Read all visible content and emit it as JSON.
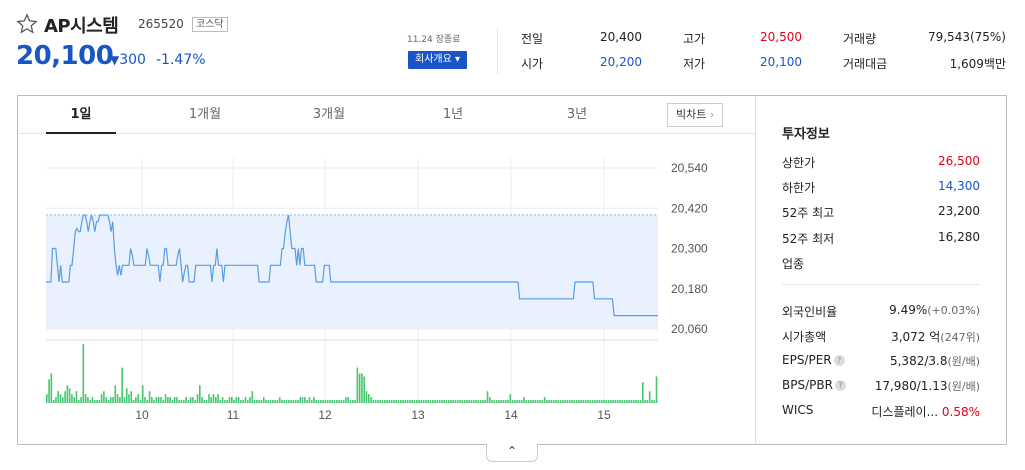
{
  "header": {
    "name": "AP시스템",
    "code": "265520",
    "market": "코스닥",
    "price": "20,100",
    "change_arrow": "▼",
    "change": "300",
    "rate": "-1.47%",
    "time": "11.24 장종료",
    "company_button": "회사개요 ▾"
  },
  "quotes": {
    "prev_label": "전일",
    "prev": "20,400",
    "high_label": "고가",
    "high": "20,500",
    "volume_label": "거래량",
    "volume": "79,543(75%)",
    "open_label": "시가",
    "open": "20,200",
    "low_label": "저가",
    "low": "20,100",
    "amount_label": "거래대금",
    "amount": "1,609백만"
  },
  "tabs": [
    "1일",
    "1개월",
    "3개월",
    "1년",
    "3년"
  ],
  "big_chart_button": "빅차트",
  "investment": {
    "title": "투자정보",
    "rows": [
      {
        "label": "상한가",
        "value": "26,500",
        "color": "red"
      },
      {
        "label": "하한가",
        "value": "14,300",
        "color": "blue"
      },
      {
        "label": "52주 최고",
        "value": "23,200",
        "color": ""
      },
      {
        "label": "52주 최저",
        "value": "16,280",
        "color": ""
      },
      {
        "label": "업종",
        "value": "",
        "color": ""
      }
    ],
    "rows2": [
      {
        "label": "외국인비율",
        "value": "9.49%",
        "extra": "(+0.03%)"
      },
      {
        "label": "시가총액",
        "value": "3,072 억",
        "extra": "(247위)"
      },
      {
        "label": "EPS/PER",
        "value": "5,382/3.8",
        "extra": "(원/배)"
      },
      {
        "label": "BPS/PBR",
        "value": "17,980/1.13",
        "extra": "(원/배)"
      },
      {
        "label": "WICS",
        "value": "디스플레이...",
        "extra": "0.58%"
      }
    ]
  },
  "chart_data": {
    "type": "line",
    "y_ticks": [
      "20,540",
      "20,420",
      "20,300",
      "20,180",
      "20,060"
    ],
    "x_ticks": [
      "10",
      "11",
      "12",
      "13",
      "14",
      "15"
    ],
    "prev_close": 20400,
    "ylim": [
      20060,
      20540
    ],
    "colors": {
      "line": "#5a9be8",
      "fill": "#e8f1fd",
      "volume": "#46c66c"
    },
    "price": [
      20200,
      20200,
      20200,
      20200,
      20300,
      20300,
      20300,
      20250,
      20200,
      20250,
      20200,
      20200,
      20200,
      20200,
      20200,
      20250,
      20250,
      20300,
      20350,
      20360,
      20350,
      20350,
      20380,
      20400,
      20400,
      20380,
      20350,
      20380,
      20400,
      20380,
      20350,
      20380,
      20380,
      20400,
      20400,
      20400,
      20400,
      20400,
      20400,
      20380,
      20350,
      20380,
      20300,
      20250,
      20220,
      20250,
      20220,
      20250,
      20250,
      20250,
      20250,
      20250,
      20300,
      20280,
      20250,
      20250,
      20250,
      20250,
      20250,
      20250,
      20250,
      20250,
      20300,
      20280,
      20250,
      20250,
      20250,
      20250,
      20250,
      20250,
      20200,
      20250,
      20250,
      20300,
      20300,
      20250,
      20250,
      20250,
      20250,
      20250,
      20250,
      20280,
      20300,
      20250,
      20200,
      20230,
      20250,
      20250,
      20200,
      20200,
      20200,
      20200,
      20250,
      20250,
      20250,
      20250,
      20250,
      20250,
      20250,
      20250,
      20250,
      20250,
      20200,
      20250,
      20250,
      20300,
      20250,
      20250,
      20250,
      20200,
      20250,
      20250,
      20250,
      20250,
      20250,
      20250,
      20250,
      20250,
      20250,
      20250,
      20250,
      20250,
      20250,
      20250,
      20250,
      20250,
      20250,
      20250,
      20250,
      20250,
      20250,
      20200,
      20200,
      20200,
      20200,
      20200,
      20200,
      20200,
      20250,
      20250,
      20250,
      20250,
      20250,
      20250,
      20250,
      20300,
      20300,
      20350,
      20380,
      20400,
      20350,
      20300,
      20300,
      20300,
      20250,
      20300,
      20250,
      20300,
      20300,
      20250,
      20250,
      20250,
      20250,
      20250,
      20250,
      20250,
      20200,
      20200,
      20200,
      20200,
      20200,
      20250,
      20250,
      20250,
      20250,
      20200,
      20200,
      20200,
      20200,
      20200,
      20200,
      20200,
      20200,
      20200,
      20200,
      20200,
      20200,
      20200,
      20200,
      20200,
      20200,
      20200,
      20200,
      20200,
      20200,
      20200,
      20200,
      20200,
      20200,
      20200,
      20200,
      20200,
      20200,
      20200,
      20200,
      20200,
      20200,
      20200,
      20200,
      20200,
      20200,
      20200,
      20200,
      20200,
      20200,
      20200,
      20200,
      20200,
      20200,
      20200,
      20200,
      20200,
      20200,
      20200,
      20200,
      20200,
      20200,
      20200,
      20200,
      20200,
      20200,
      20200,
      20200,
      20200,
      20200,
      20200,
      20200,
      20200,
      20200,
      20200,
      20200,
      20200,
      20200,
      20200,
      20200,
      20200,
      20200,
      20200,
      20200,
      20200,
      20200,
      20200,
      20200,
      20200,
      20200,
      20200,
      20200,
      20200,
      20200,
      20200,
      20200,
      20200,
      20200,
      20200,
      20200,
      20200,
      20200,
      20200,
      20200,
      20200,
      20200,
      20200,
      20200,
      20200,
      20200,
      20200,
      20200,
      20200,
      20200,
      20200,
      20200,
      20200,
      20200,
      20200,
      20200,
      20200,
      20200,
      20200,
      20200,
      20200,
      20200,
      20150,
      20150,
      20150,
      20150,
      20150,
      20150,
      20150,
      20150,
      20150,
      20150,
      20150,
      20150,
      20150,
      20150,
      20150,
      20150,
      20150,
      20150,
      20150,
      20150,
      20150,
      20150,
      20150,
      20150,
      20150,
      20150,
      20150,
      20150,
      20150,
      20150,
      20150,
      20150,
      20150,
      20150,
      20200,
      20200,
      20200,
      20200,
      20200,
      20200,
      20200,
      20200,
      20200,
      20200,
      20200,
      20200,
      20150,
      20150,
      20150,
      20150,
      20150,
      20150,
      20150,
      20150,
      20150,
      20150,
      20150,
      20150,
      20100,
      20100,
      20100,
      20100,
      20100,
      20100,
      20100,
      20100,
      20100,
      20100,
      20100,
      20100,
      20100,
      20100,
      20100,
      20100,
      20100,
      20100,
      20100,
      20100,
      20100,
      20100,
      20100,
      20100,
      20100,
      20100,
      20100,
      20100
    ],
    "volume": [
      3,
      8,
      10,
      1,
      2,
      4,
      3,
      2,
      4,
      6,
      5,
      3,
      2,
      4,
      1,
      2,
      20,
      3,
      2,
      1,
      2,
      1,
      1,
      1,
      3,
      4,
      2,
      1,
      2,
      2,
      6,
      3,
      2,
      12,
      2,
      5,
      3,
      4,
      1,
      2,
      3,
      1,
      6,
      2,
      1,
      4,
      2,
      1,
      2,
      2,
      2,
      1,
      3,
      2,
      2,
      1,
      2,
      2,
      1,
      1,
      1,
      2,
      1,
      2,
      2,
      1,
      3,
      6,
      2,
      1,
      1,
      3,
      2,
      3,
      2,
      3,
      1,
      2,
      1,
      1,
      2,
      2,
      1,
      2,
      2,
      1,
      1,
      2,
      1,
      2,
      4,
      1,
      1,
      1,
      1,
      2,
      1,
      1,
      1,
      1,
      1,
      1,
      2,
      1,
      1,
      1,
      1,
      1,
      1,
      1,
      1,
      2,
      2,
      2,
      1,
      2,
      1,
      2,
      1,
      1,
      1,
      1,
      1,
      1,
      1,
      1,
      1,
      1,
      1,
      1,
      1,
      2,
      2,
      1,
      1,
      1,
      12,
      10,
      10,
      9,
      4,
      3,
      2,
      1,
      1,
      1,
      1,
      1,
      1,
      1,
      1,
      1,
      1,
      1,
      1,
      1,
      1,
      1,
      1,
      1,
      1,
      1,
      1,
      1,
      1,
      1,
      1,
      1,
      1,
      1,
      1,
      1,
      1,
      1,
      1,
      1,
      1,
      1,
      1,
      1,
      1,
      1,
      1,
      1,
      1,
      1,
      1,
      1,
      1,
      1,
      1,
      1,
      1,
      4,
      2,
      1,
      1,
      1,
      1,
      1,
      1,
      1,
      1,
      3,
      1,
      1,
      1,
      1,
      1,
      2,
      1,
      1,
      1,
      1,
      1,
      1,
      1,
      1,
      2,
      1,
      1,
      1,
      1,
      1,
      1,
      1,
      1,
      1,
      1,
      1,
      1,
      1,
      1,
      1,
      1,
      1,
      1,
      1,
      1,
      1,
      1,
      1,
      1,
      1,
      1,
      1,
      1,
      1,
      1,
      1,
      1,
      1,
      1,
      1,
      1,
      1,
      1,
      1,
      1,
      1,
      1,
      7,
      1,
      1,
      4,
      1,
      1,
      9
    ]
  }
}
